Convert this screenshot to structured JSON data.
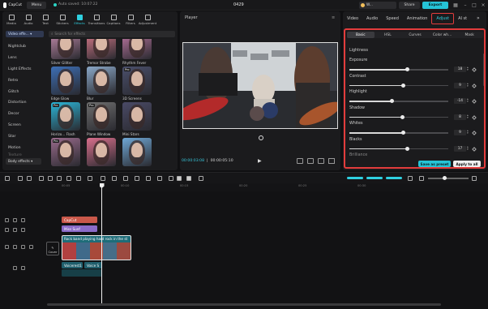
{
  "app": {
    "name": "CapCut",
    "menu_label": "Menu",
    "autosave": "Auto saved: 10:07:22",
    "project_title": "0429",
    "user_label": "W...",
    "share_label": "Share",
    "export_label": "Export"
  },
  "left": {
    "tabs": [
      {
        "label": "Media"
      },
      {
        "label": "Audio"
      },
      {
        "label": "Text"
      },
      {
        "label": "Stickers"
      },
      {
        "label": "Effects"
      },
      {
        "label": "Transitions"
      },
      {
        "label": "Captions"
      },
      {
        "label": "Filters"
      },
      {
        "label": "Adjustment"
      }
    ],
    "dropdown_label": "Video effe...",
    "search_placeholder": "Search for effects",
    "categories": [
      "Nightclub",
      "Lens",
      "Light Effects",
      "Retro",
      "Glitch",
      "Distortion",
      "Decor",
      "Screen",
      "Star",
      "Motion",
      "Texture"
    ],
    "body_effects_label": "Body effects",
    "effects": [
      {
        "label": "Silver Glitter",
        "bg": "#c98fb0",
        "pro": false
      },
      {
        "label": "Tremor Strobe",
        "bg": "#e07d8e",
        "pro": false
      },
      {
        "label": "Rhythm Fever",
        "bg": "#c47aa7",
        "pro": false
      },
      {
        "label": "Edge Glow",
        "bg": "#3d6fb6",
        "pro": false
      },
      {
        "label": "Blur",
        "bg": "#8aa8c8",
        "pro": false
      },
      {
        "label": "3D Screens",
        "bg": "#4a4f6b",
        "pro": true
      },
      {
        "label": "Horizo... Flash",
        "bg": "#2bb7d9",
        "pro": true
      },
      {
        "label": "Plane Window",
        "bg": "#6e6e6e",
        "pro": true
      },
      {
        "label": "Mini Stars",
        "bg": "#4a4a66",
        "pro": false
      },
      {
        "label": "",
        "bg": "#9a6b8c",
        "pro": true
      },
      {
        "label": "",
        "bg": "#d96f8c",
        "pro": false
      },
      {
        "label": "",
        "bg": "#6fa8d6",
        "pro": false
      }
    ]
  },
  "player": {
    "title": "Player",
    "current_time": "00:00:03:08",
    "total_time": "00:00:05:10"
  },
  "inspector": {
    "tabs": [
      {
        "label": "Video"
      },
      {
        "label": "Audio"
      },
      {
        "label": "Speed"
      },
      {
        "label": "Animation"
      },
      {
        "label": "Adjust"
      },
      {
        "label": "AI st"
      }
    ],
    "subtabs": [
      "Basic",
      "HSL",
      "Curves",
      "Color wh...",
      "Mask"
    ],
    "section_label": "Lightness",
    "adjustments": [
      {
        "label": "Exposure",
        "value": "18",
        "level": 0.59
      },
      {
        "label": "Contrast",
        "value": "9",
        "level": 0.545
      },
      {
        "label": "Highlight",
        "value": "-14",
        "level": 0.43
      },
      {
        "label": "Shadow",
        "value": "8",
        "level": 0.54
      },
      {
        "label": "Whites",
        "value": "9",
        "level": 0.545
      },
      {
        "label": "Blacks",
        "value": "17",
        "level": 0.585
      },
      {
        "label": "Brilliance",
        "value": "",
        "level": 0.5
      }
    ],
    "save_preset_label": "Save as preset",
    "apply_all_label": "Apply to all"
  },
  "timeline": {
    "ticks": [
      "00:05",
      "00:10",
      "00:15",
      "00:20",
      "00:25",
      "00:30"
    ],
    "clips": {
      "effect1": "CapCut",
      "effect2": "Miss Sunf",
      "video_title": "Rock band playing hard rock in the st",
      "sub1": "Voicerest1",
      "sub2": "Voice S"
    },
    "cover_label": "Cover"
  }
}
